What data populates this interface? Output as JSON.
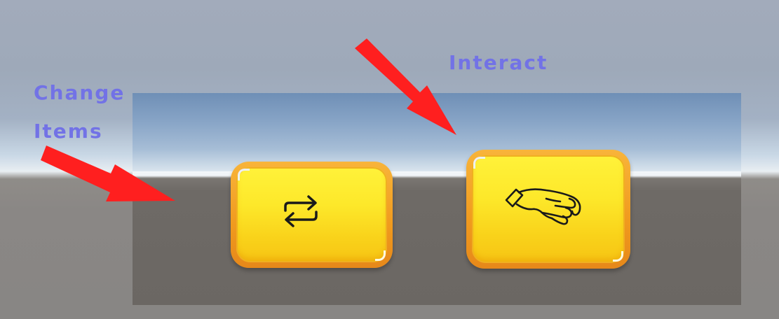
{
  "annotations": {
    "change_items_line1": "Change",
    "change_items_line2": "Items",
    "interact": "Interact"
  },
  "buttons": [
    {
      "id": "change-items",
      "icon": "swap-arrows-icon"
    },
    {
      "id": "interact",
      "icon": "hand-icon"
    }
  ],
  "colors": {
    "annotation_text": "#7272e6",
    "arrow": "#ff1f1f",
    "button_face": "#fde82a",
    "button_rim": "#f4a423",
    "icon_stroke": "#1a1a1a"
  }
}
